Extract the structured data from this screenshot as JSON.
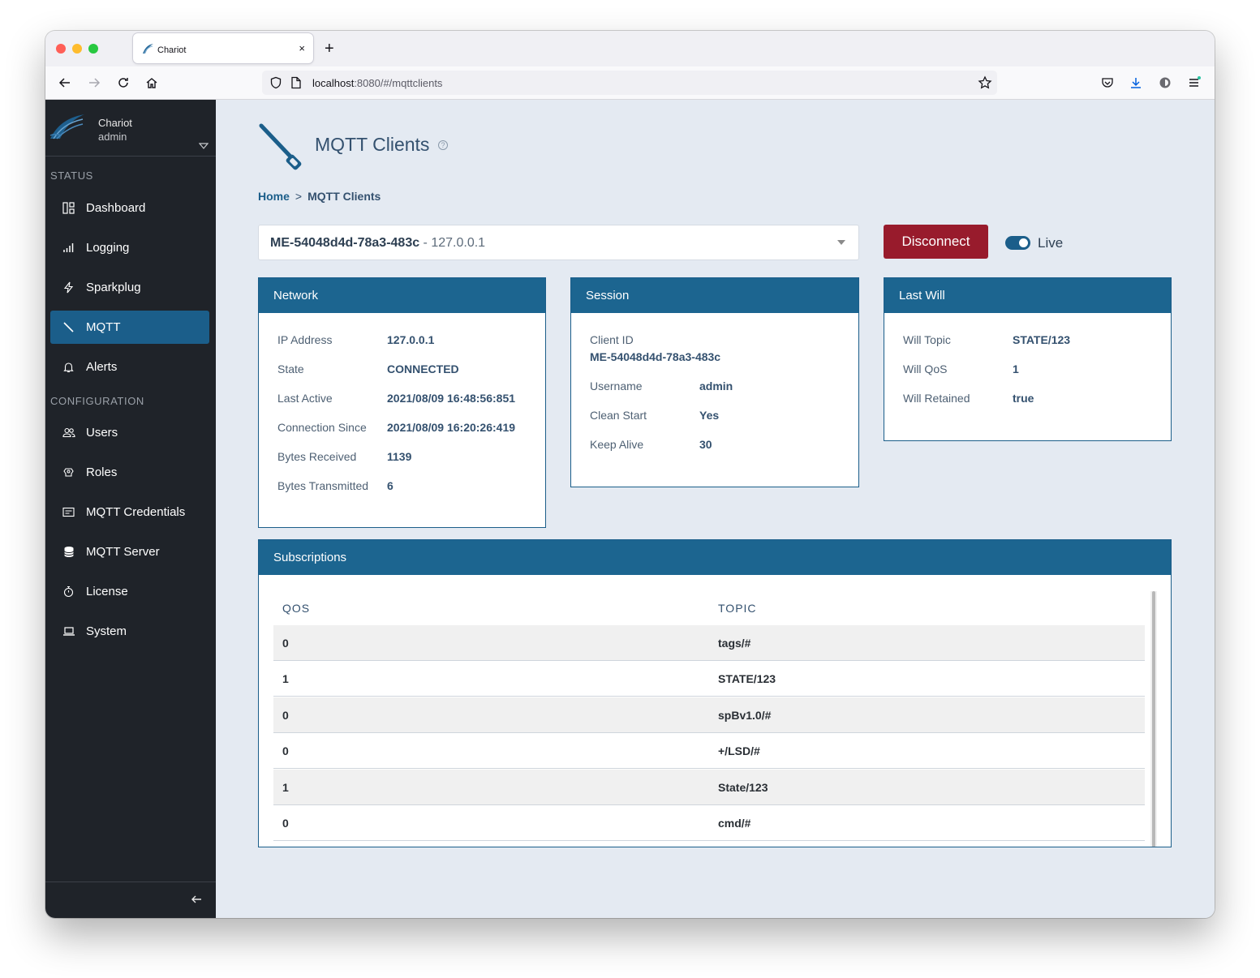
{
  "browser": {
    "tab_title": "Chariot",
    "tab_close": "×",
    "new_tab": "+",
    "url_host": "localhost",
    "url_path": ":8080/#/mqttclients"
  },
  "sidebar": {
    "brand_name": "Chariot",
    "user": "admin",
    "status_label": "STATUS",
    "config_label": "CONFIGURATION",
    "status_items": [
      {
        "label": "Dashboard",
        "icon": "dashboard-icon"
      },
      {
        "label": "Logging",
        "icon": "bar-chart-icon"
      },
      {
        "label": "Sparkplug",
        "icon": "lightning-icon"
      },
      {
        "label": "MQTT",
        "icon": "wrench-icon",
        "active": true
      },
      {
        "label": "Alerts",
        "icon": "bell-icon"
      }
    ],
    "config_items": [
      {
        "label": "Users",
        "icon": "users-icon"
      },
      {
        "label": "Roles",
        "icon": "roles-icon"
      },
      {
        "label": "MQTT Credentials",
        "icon": "credentials-icon"
      },
      {
        "label": "MQTT Server",
        "icon": "database-icon"
      },
      {
        "label": "License",
        "icon": "stopwatch-icon"
      },
      {
        "label": "System",
        "icon": "laptop-icon"
      }
    ]
  },
  "page": {
    "title": "MQTT Clients",
    "help": "?",
    "breadcrumb_home": "Home",
    "breadcrumb_sep": ">",
    "breadcrumb_current": "MQTT Clients",
    "client_id": "ME-54048d4d-78a3-483c",
    "client_ip": " - 127.0.0.1",
    "disconnect_label": "Disconnect",
    "live_label": "Live",
    "live_on": true
  },
  "network": {
    "title": "Network",
    "ip_label": "IP Address",
    "ip": "127.0.0.1",
    "state_label": "State",
    "state": "CONNECTED",
    "last_active_label": "Last Active",
    "last_active": "2021/08/09 16:48:56:851",
    "since_label": "Connection Since",
    "since": "2021/08/09 16:20:26:419",
    "rx_label": "Bytes Received",
    "rx": "1139",
    "tx_label": "Bytes Transmitted",
    "tx": "6"
  },
  "session": {
    "title": "Session",
    "client_id_label": "Client ID",
    "client_id": "ME-54048d4d-78a3-483c",
    "username_label": "Username",
    "username": "admin",
    "clean_start_label": "Clean Start",
    "clean_start": "Yes",
    "keep_alive_label": "Keep Alive",
    "keep_alive": "30"
  },
  "last_will": {
    "title": "Last Will",
    "topic_label": "Will Topic",
    "topic": "STATE/123",
    "qos_label": "Will QoS",
    "qos": "1",
    "retained_label": "Will Retained",
    "retained": "true"
  },
  "subscriptions": {
    "title": "Subscriptions",
    "col_qos": "QOS",
    "col_topic": "TOPIC",
    "rows": [
      {
        "qos": "0",
        "topic": "tags/#"
      },
      {
        "qos": "1",
        "topic": "STATE/123"
      },
      {
        "qos": "0",
        "topic": "spBv1.0/#"
      },
      {
        "qos": "0",
        "topic": "+/LSD/#"
      },
      {
        "qos": "1",
        "topic": "State/123"
      },
      {
        "qos": "0",
        "topic": "cmd/#"
      }
    ]
  },
  "colors": {
    "accent": "#1b5e8a",
    "sidebar_bg": "#1f2329",
    "danger": "#981b2c",
    "page_bg": "#e4eaf2"
  }
}
